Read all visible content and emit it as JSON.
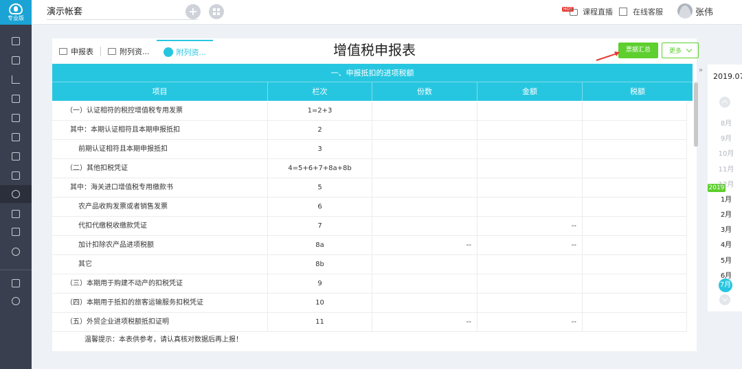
{
  "logo": {
    "text": "专业版"
  },
  "topbar": {
    "account_name": "演示帐套",
    "live_badge": "HOT",
    "live_label": "课程直播",
    "service_label": "在线客服",
    "user_name": "张伟"
  },
  "tabs": [
    {
      "label": "申报表",
      "icon": "form-icon"
    },
    {
      "label": "附列资...",
      "icon": "document-icon"
    },
    {
      "label": "附列资...",
      "icon": "document-icon"
    }
  ],
  "page_title": "增值税申报表",
  "actions": {
    "summary_label": "票据汇总",
    "more_label": "更多"
  },
  "table": {
    "section_title": "一、申报抵扣的进项税额",
    "columns": [
      "项目",
      "栏次",
      "份数",
      "金额",
      "税额"
    ],
    "rows": [
      {
        "item": "（一）认证相符的税控增值税专用发票",
        "line": "1=2+3",
        "count": "",
        "amount": "",
        "tax": "",
        "indent": 0
      },
      {
        "item": "其中：本期认证相符且本期申报抵扣",
        "line": "2",
        "count": "",
        "amount": "",
        "tax": "",
        "indent": 1
      },
      {
        "item": "前期认证相符且本期申报抵扣",
        "line": "3",
        "count": "",
        "amount": "",
        "tax": "",
        "indent": 2
      },
      {
        "item": "（二）其他扣税凭证",
        "line": "4=5+6+7+8a+8b",
        "count": "",
        "amount": "",
        "tax": "",
        "indent": 0
      },
      {
        "item": "其中：海关进口增值税专用缴款书",
        "line": "5",
        "count": "",
        "amount": "",
        "tax": "",
        "indent": 1
      },
      {
        "item": "农产品收购发票或者销售发票",
        "line": "6",
        "count": "",
        "amount": "",
        "tax": "",
        "indent": 2
      },
      {
        "item": "代扣代缴税收缴款凭证",
        "line": "7",
        "count": "",
        "amount": "--",
        "tax": "",
        "indent": 2
      },
      {
        "item": "加计扣除农产品进项税额",
        "line": "8a",
        "count": "--",
        "amount": "--",
        "tax": "",
        "indent": 2
      },
      {
        "item": "其它",
        "line": "8b",
        "count": "",
        "amount": "",
        "tax": "",
        "indent": 2
      },
      {
        "item": "（三）本期用于购建不动产的扣税凭证",
        "line": "9",
        "count": "",
        "amount": "",
        "tax": "",
        "indent": 0
      },
      {
        "item": "（四）本期用于抵扣的旅客运输服务扣税凭证",
        "line": "10",
        "count": "",
        "amount": "",
        "tax": "",
        "indent": 0
      },
      {
        "item": "（五）外贸企业进项税额抵扣证明",
        "line": "11",
        "count": "--",
        "amount": "--",
        "tax": "",
        "indent": 0
      }
    ]
  },
  "tip": "温馨提示：本表供参考，请认真核对数据后再上报！",
  "calendar": {
    "toggle_glyph": "»",
    "current_period": "2019.07",
    "year_badge": "2019",
    "months_prev_year": [
      "8月",
      "9月",
      "10月",
      "11月",
      "12月"
    ],
    "months_current_year": [
      "1月",
      "2月",
      "3月",
      "4月",
      "5月",
      "6月"
    ],
    "selected_month": "7月"
  },
  "colors": {
    "accent": "#27c6e0",
    "green": "#5dcf2e",
    "sidebar": "#3a3f4f",
    "arrow": "#e53935"
  }
}
